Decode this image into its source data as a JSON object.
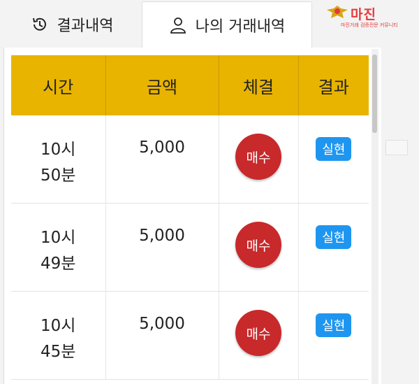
{
  "tabs": {
    "results": {
      "label": "결과내역",
      "icon": "history-icon"
    },
    "my_trades": {
      "label": "나의 거래내역",
      "icon": "user-icon"
    }
  },
  "logo": {
    "text": "마진",
    "subtext": "마진거래 검증전문 커뮤니티"
  },
  "table": {
    "headers": {
      "time": "시간",
      "amount": "금액",
      "execution": "체결",
      "result": "결과"
    },
    "rows": [
      {
        "time_hour": "10시",
        "time_min": "50분",
        "amount": "5,000",
        "execution": "매수",
        "result": "실현"
      },
      {
        "time_hour": "10시",
        "time_min": "49분",
        "amount": "5,000",
        "execution": "매수",
        "result": "실현"
      },
      {
        "time_hour": "10시",
        "time_min": "45분",
        "amount": "5,000",
        "execution": "매수",
        "result": "실현"
      }
    ]
  },
  "colors": {
    "header_bg": "#e8b400",
    "buy_badge": "#c8292b",
    "realized_badge": "#1e96f0",
    "logo_red": "#e5383b"
  }
}
